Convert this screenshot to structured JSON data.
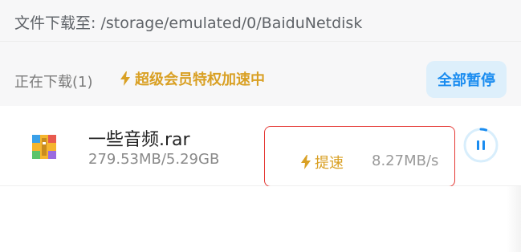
{
  "header": {
    "path_label": "文件下载至: /storage/emulated/0/BaiduNetdisk"
  },
  "status": {
    "downloading_label": "正在下载(1)",
    "vip_promo_label": "超级会员特权加速中",
    "pause_all_label": "全部暂停"
  },
  "download_item": {
    "file_name": "一些音频.rar",
    "progress_text": "279.53MB/5.29GB",
    "boost_label": "提速",
    "speed": "8.27MB/s",
    "progress_fraction": 0.053
  },
  "colors": {
    "accent_blue": "#1a8cf0",
    "vip_gold": "#d9a024",
    "highlight_red": "#e53935"
  },
  "icons": {
    "vip_promo": "lightning-bolt-icon",
    "boost": "lightning-bolt-icon",
    "file": "archive-file-icon",
    "pause": "pause-icon"
  }
}
